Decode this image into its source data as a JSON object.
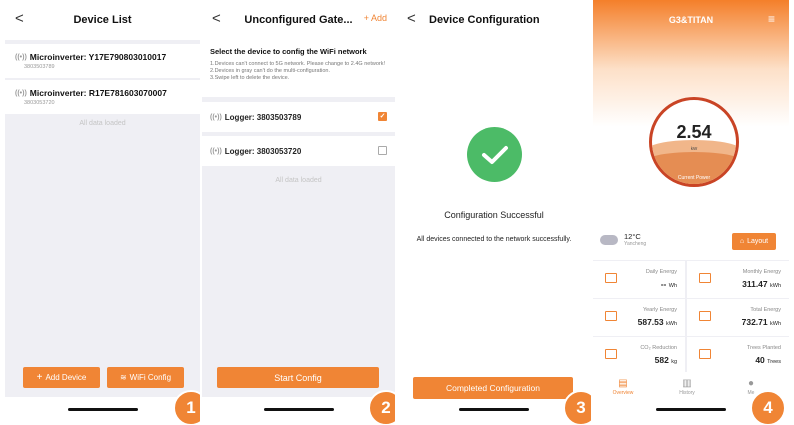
{
  "steps": [
    "1",
    "2",
    "3",
    "4"
  ],
  "screen1": {
    "title": "Device List",
    "back": "<",
    "devices": [
      {
        "name": "Microinverter: Y17E790803010017",
        "sn": "3803503789"
      },
      {
        "name": "Microinverter: R17E781603070007",
        "sn": "3803053720"
      }
    ],
    "loaded_text": "All data loaded",
    "add_device": "Add Device",
    "wifi_config": "WiFi Config"
  },
  "screen2": {
    "title": "Unconfigured Gate...",
    "back": "<",
    "add": "+ Add",
    "instr_title": "Select the device to config the WiFi network",
    "instructions": [
      "1.Devices can't connect to 5G network. Please change to 2.4G network!",
      "2.Devices in gray can't do the multi-configuration.",
      "3.Swipe left to delete the device."
    ],
    "loggers": [
      {
        "label": "Logger: 3803503789",
        "checked": true
      },
      {
        "label": "Logger: 3803053720",
        "checked": false
      }
    ],
    "loaded_text": "All data loaded",
    "start_btn": "Start Config"
  },
  "screen3": {
    "title": "Device Configuration",
    "back": "<",
    "success_title": "Configuration Successful",
    "success_msg": "All devices connected to the network successfully.",
    "complete_btn": "Completed Configuration"
  },
  "screen4": {
    "title": "G3&TITAN",
    "menu_icon": "menu-icon",
    "power_value": "2.54",
    "power_unit": "kW",
    "power_label": "Current Power",
    "temp": "12°C",
    "city": "Yancheng",
    "layout_btn": "Layout",
    "stats": [
      {
        "label": "Daily Energy",
        "value": "-- ",
        "unit": "Wh"
      },
      {
        "label": "Monthly Energy",
        "value": "311.47 ",
        "unit": "kWh"
      },
      {
        "label": "Yearly Energy",
        "value": "587.53 ",
        "unit": "kWh"
      },
      {
        "label": "Total Energy",
        "value": "732.71 ",
        "unit": "kWh"
      },
      {
        "label": "CO₂ Reduction",
        "value": "582 ",
        "unit": "kg"
      },
      {
        "label": "Trees Planted",
        "value": "40 ",
        "unit": "Trees"
      }
    ],
    "tabs": [
      {
        "label": "Overview",
        "icon": "overview-icon"
      },
      {
        "label": "History",
        "icon": "history-icon"
      },
      {
        "label": "Me",
        "icon": "me-icon"
      }
    ]
  },
  "colors": {
    "accent": "#f08535",
    "success": "#4cbb67",
    "gauge_ring": "#c94425"
  }
}
